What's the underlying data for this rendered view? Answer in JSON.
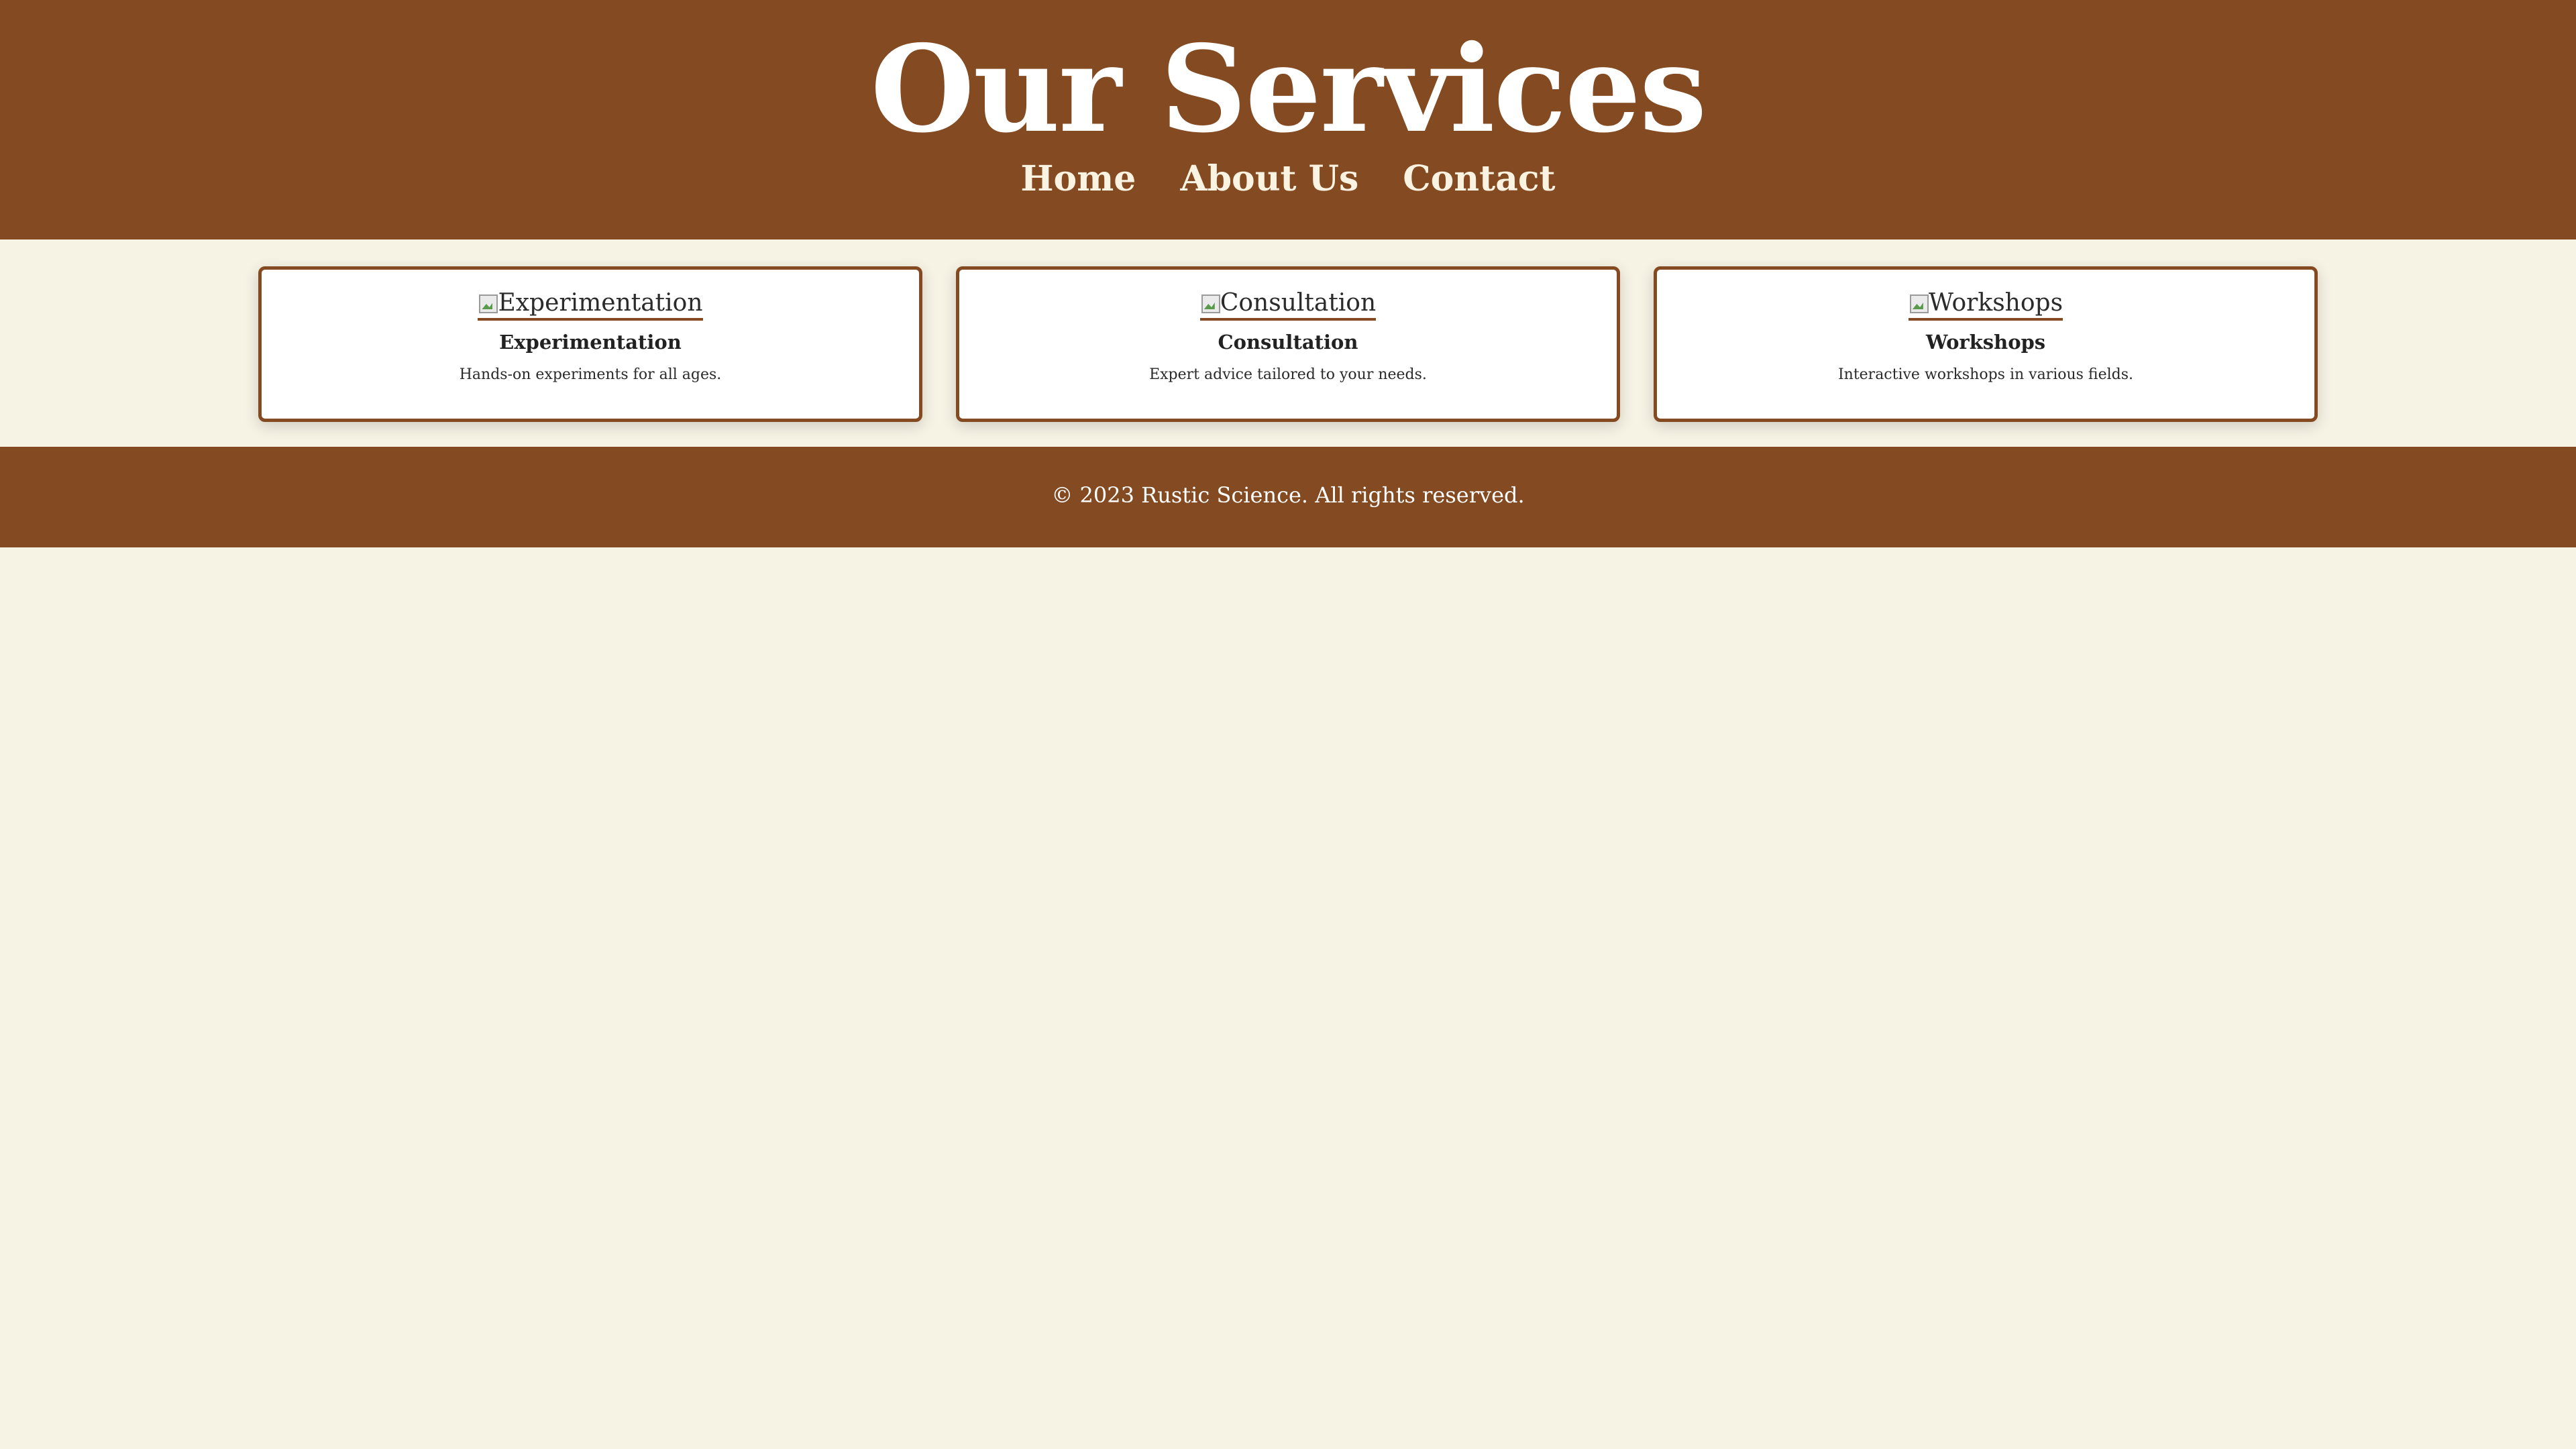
{
  "header": {
    "title": "Our Services",
    "nav": [
      {
        "label": "Home"
      },
      {
        "label": "About Us"
      },
      {
        "label": "Contact"
      }
    ]
  },
  "services": [
    {
      "image_alt": "Experimentation",
      "image_icon": "broken-image-icon",
      "title": "Experimentation",
      "description": "Hands-on experiments for all ages."
    },
    {
      "image_alt": "Consultation",
      "image_icon": "broken-image-icon",
      "title": "Consultation",
      "description": "Expert advice tailored to your needs."
    },
    {
      "image_alt": "Workshops",
      "image_icon": "broken-image-icon",
      "title": "Workshops",
      "description": "Interactive workshops in various fields."
    }
  ],
  "footer": {
    "text": "© 2023 Rustic Science. All rights reserved."
  },
  "colors": {
    "brand_brown": "#844a21",
    "page_background": "#f6f2e4",
    "card_background": "#ffffff"
  }
}
